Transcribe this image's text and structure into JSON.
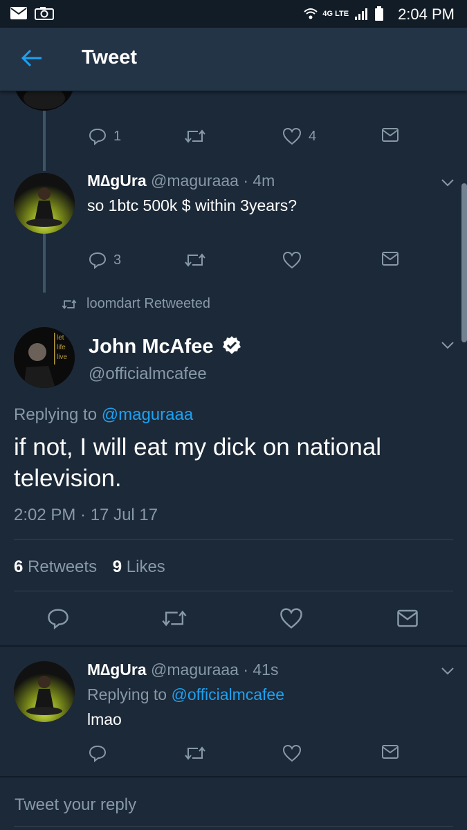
{
  "status_bar": {
    "network": "4G LTE",
    "time": "2:04 PM"
  },
  "header": {
    "title": "Tweet"
  },
  "tweet_top_actions": {
    "reply_count": "1",
    "like_count": "4"
  },
  "reply1": {
    "name": "M∆gUra",
    "handle": "@maguraaa · 4m",
    "text": "so 1btc 500k $ within 3years?",
    "reply_count": "3"
  },
  "retweet_context": {
    "label": "loomdart Retweeted"
  },
  "main_tweet": {
    "name": "John McAfee",
    "handle": "@officialmcafee",
    "avatar_text": [
      "let",
      "life",
      "live"
    ],
    "replying_prefix": "Replying to ",
    "replying_to": "@maguraaa",
    "text_line1": "if not, I will eat my dick on national",
    "text_line2": "television.",
    "timestamp": "2:02 PM · 17 Jul 17",
    "retweet_count": "6",
    "retweet_label": "Retweets",
    "like_count": "9",
    "like_label": "Likes"
  },
  "reply2": {
    "name": "M∆gUra",
    "handle": "@maguraaa · 41s",
    "replying_prefix": "Replying to ",
    "replying_to": "@officialmcafee",
    "text": "lmao"
  },
  "reply_box": {
    "placeholder": "Tweet your reply"
  },
  "colors": {
    "background": "#1c2938",
    "header": "#243447",
    "accent": "#1da1f2",
    "muted": "#8899a6"
  }
}
